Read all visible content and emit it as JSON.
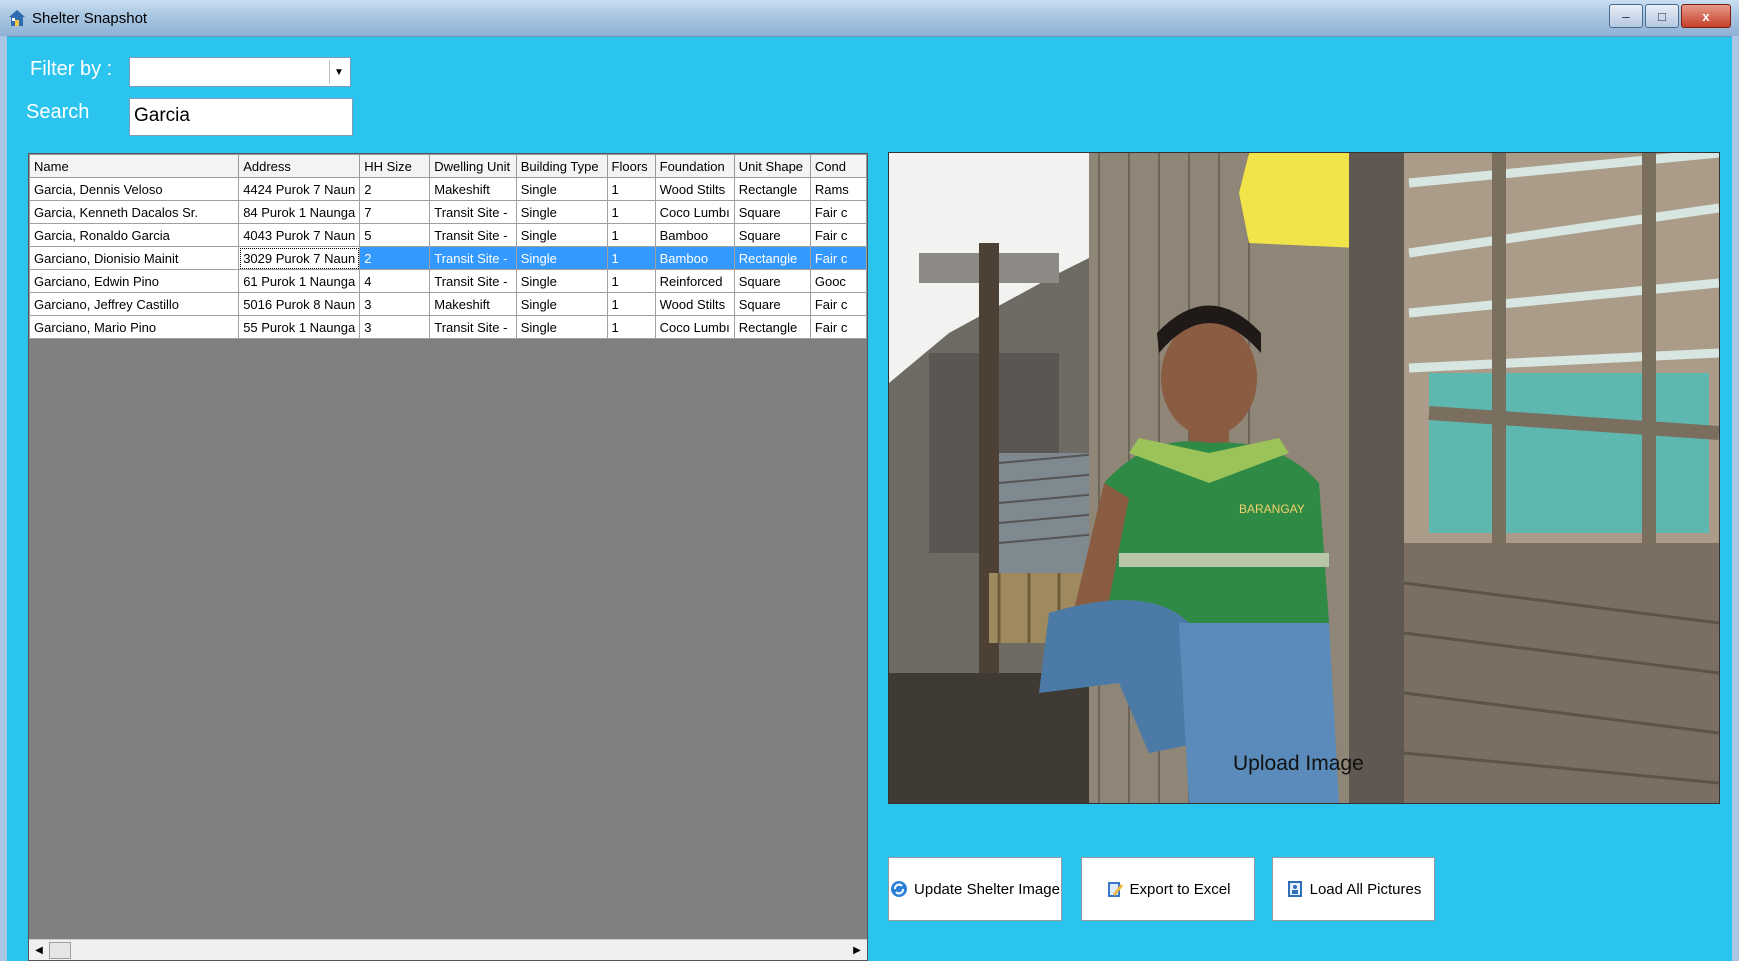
{
  "window": {
    "title": "Shelter Snapshot",
    "buttons": {
      "minimize": "–",
      "maximize": "□",
      "close": "x"
    }
  },
  "filter": {
    "label": "Filter by :",
    "value": ""
  },
  "search": {
    "label": "Search",
    "value": "Garcia"
  },
  "grid": {
    "columns": [
      "Name",
      "Address",
      "HH Size",
      "Dwelling Unit",
      "Building Type",
      "Floors",
      "Foundation",
      "Unit Shape",
      "Cond"
    ],
    "rows": [
      [
        "Garcia, Dennis Veloso",
        "4424 Purok 7 Naun",
        "2",
        "Makeshift",
        "Single",
        "1",
        "Wood Stilts",
        "Rectangle",
        "Rams"
      ],
      [
        "Garcia, Kenneth Dacalos Sr.",
        "84 Purok 1 Naunga",
        "7",
        "Transit Site -",
        "Single",
        "1",
        "Coco Lumbı",
        "Square",
        "Fair c"
      ],
      [
        "Garcia, Ronaldo Garcia",
        "4043 Purok 7 Naun",
        "5",
        "Transit Site -",
        "Single",
        "1",
        "Bamboo",
        "Square",
        "Fair c"
      ],
      [
        "Garciano, Dionisio Mainit",
        "3029 Purok 7 Naun",
        "2",
        "Transit Site -",
        "Single",
        "1",
        "Bamboo",
        "Rectangle",
        "Fair c"
      ],
      [
        "Garciano, Edwin Pino",
        "61 Purok 1 Naunga",
        "4",
        "Transit Site -",
        "Single",
        "1",
        "Reinforced",
        "Square",
        "Gooc"
      ],
      [
        "Garciano, Jeffrey Castillo",
        "5016 Purok 8 Naun",
        "3",
        "Makeshift",
        "Single",
        "1",
        "Wood Stilts",
        "Square",
        "Fair c"
      ],
      [
        "Garciano, Mario Pino",
        "55 Purok 1 Naunga",
        "3",
        "Transit Site -",
        "Single",
        "1",
        "Coco Lumbı",
        "Rectangle",
        "Fair c"
      ]
    ],
    "selected_row": 3
  },
  "photo": {
    "overlay_label": "Upload Image",
    "shirt_text": "BARANGAY"
  },
  "actions": {
    "update": "Update Shelter Image",
    "export": "Export to Excel",
    "load": "Load All Pictures"
  },
  "colors": {
    "background": "#2bc4ee",
    "selection": "#3399ff",
    "grid_empty": "#808080"
  }
}
